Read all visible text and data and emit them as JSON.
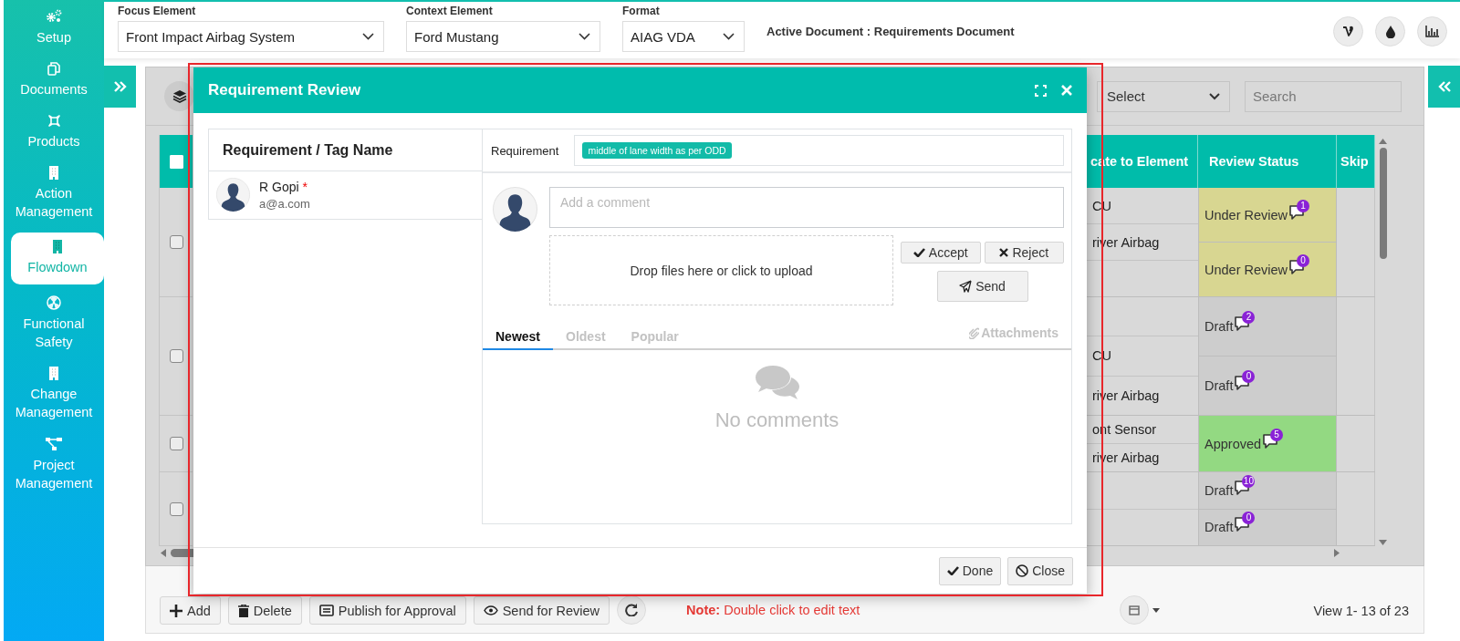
{
  "sidebar": {
    "items": [
      {
        "label": "Setup",
        "selected": false
      },
      {
        "label": "Documents",
        "selected": false
      },
      {
        "label": "Products",
        "selected": false
      },
      {
        "label": "Action Management",
        "selected": false
      },
      {
        "label": "Flowdown",
        "selected": true
      },
      {
        "label": "Functional Safety",
        "selected": false
      },
      {
        "label": "Change Management",
        "selected": false
      },
      {
        "label": "Project Management",
        "selected": false
      }
    ]
  },
  "filters": [
    {
      "label": "Focus Element",
      "value": "Front Impact Airbag System"
    },
    {
      "label": "Context Element",
      "value": "Ford Mustang"
    },
    {
      "label": "Format",
      "value": "AIAG VDA"
    }
  ],
  "active_document": "Active Document : Requirements Document",
  "grid": {
    "filter_select": {
      "value": "Select"
    },
    "search": {
      "placeholder": "Search"
    },
    "header_checked": false,
    "columns": [
      "cate to Element",
      "Review Status",
      "Skip"
    ],
    "rows": [
      {
        "checked": false,
        "elements": [
          "CU",
          "river Airbag"
        ],
        "statuses": [
          {
            "label": "Under Review",
            "kind": "under_review",
            "comments": "1"
          },
          {
            "label": "Under Review",
            "kind": "under_review",
            "comments": "0"
          }
        ]
      },
      {
        "checked": false,
        "elements": [
          "CU",
          "river Airbag"
        ],
        "statuses": [
          {
            "label": "Draft",
            "kind": "draft",
            "comments": "2"
          },
          {
            "label": "Draft",
            "kind": "draft",
            "comments": "0"
          }
        ]
      },
      {
        "checked": false,
        "elements": [
          "ont Sensor",
          "river Airbag"
        ],
        "statuses": [
          {
            "label": "Approved",
            "kind": "approved",
            "comments": "5"
          }
        ]
      },
      {
        "checked": false,
        "statuses": [
          {
            "label": "Draft",
            "kind": "draft",
            "comments": "10"
          },
          {
            "label": "Draft",
            "kind": "draft",
            "comments": "0"
          }
        ]
      }
    ]
  },
  "modal": {
    "title": "Requirement Review",
    "list_header": "Requirement / Tag Name",
    "reviewers": [
      {
        "name": "R Gopi",
        "required_mark": "*",
        "email": "a@a.com"
      }
    ],
    "requirement_label": "Requirement",
    "requirement_tags": [
      "middle of lane width as per ODD"
    ],
    "comment": {
      "placeholder": "Add a comment"
    },
    "dropzone": "Drop files here or click to upload",
    "review_actions": [
      "Accept",
      "Reject"
    ],
    "send": "Send",
    "tabs": [
      {
        "label": "Newest",
        "selected": true
      },
      {
        "label": "Oldest",
        "selected": false
      },
      {
        "label": "Popular",
        "selected": false
      }
    ],
    "attachments": "Attachments",
    "empty_text": "No comments",
    "footer_buttons": [
      "Done",
      "Close"
    ]
  },
  "toolbar": {
    "buttons": [
      "Add",
      "Delete",
      "Publish for Approval",
      "Send for Review"
    ],
    "note": "**Note:** Double click to edit text",
    "pager": "View 1- 13 of 23"
  }
}
